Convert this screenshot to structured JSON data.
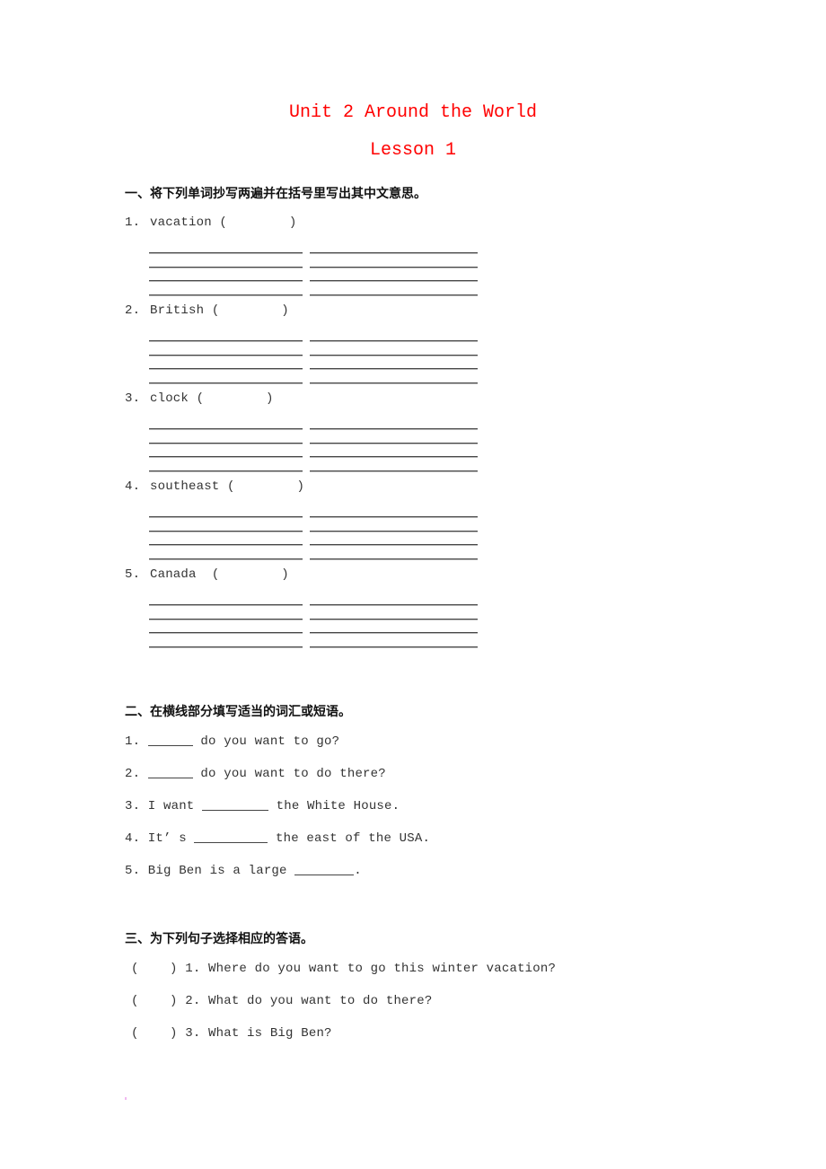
{
  "document": {
    "title": "Unit 2 Around the World",
    "subtitle": "Lesson 1",
    "title_color": "#ff0000",
    "section1": {
      "heading": "一、将下列单词抄写两遍并在括号里写出其中文意思。",
      "items": [
        {
          "num": "1.",
          "word": "vacation",
          "bracket": "(        )"
        },
        {
          "num": "2.",
          "word": "British",
          "bracket": "(        )"
        },
        {
          "num": "3.",
          "word": "clock",
          "bracket": "(        )"
        },
        {
          "num": "4.",
          "word": "southeast",
          "bracket": "(        )"
        },
        {
          "num": "5.",
          "word": "Canada",
          "bracket": " (        )"
        }
      ]
    },
    "section2": {
      "heading": "二、在横线部分填写适当的词汇或短语。",
      "items": [
        {
          "prefix": "1. ",
          "after": " do you want to go?"
        },
        {
          "prefix": "2. ",
          "after": " do you want to do there?"
        },
        {
          "prefix": "3. I want ",
          "after": " the White House."
        },
        {
          "prefix": "4. It’ s ",
          "after": " the east of the USA."
        },
        {
          "prefix": "5. Big Ben is a large ",
          "after": "."
        }
      ]
    },
    "section3": {
      "heading": "三、为下列句子选择相应的答语。",
      "items": [
        {
          "bracket": "(    )",
          "text": "1. Where do you want to go this winter vacation?"
        },
        {
          "bracket": "(    )",
          "text": "2. What do you want to do there?"
        },
        {
          "bracket": "(    )",
          "text": "3. What is Big Ben?"
        }
      ]
    }
  }
}
